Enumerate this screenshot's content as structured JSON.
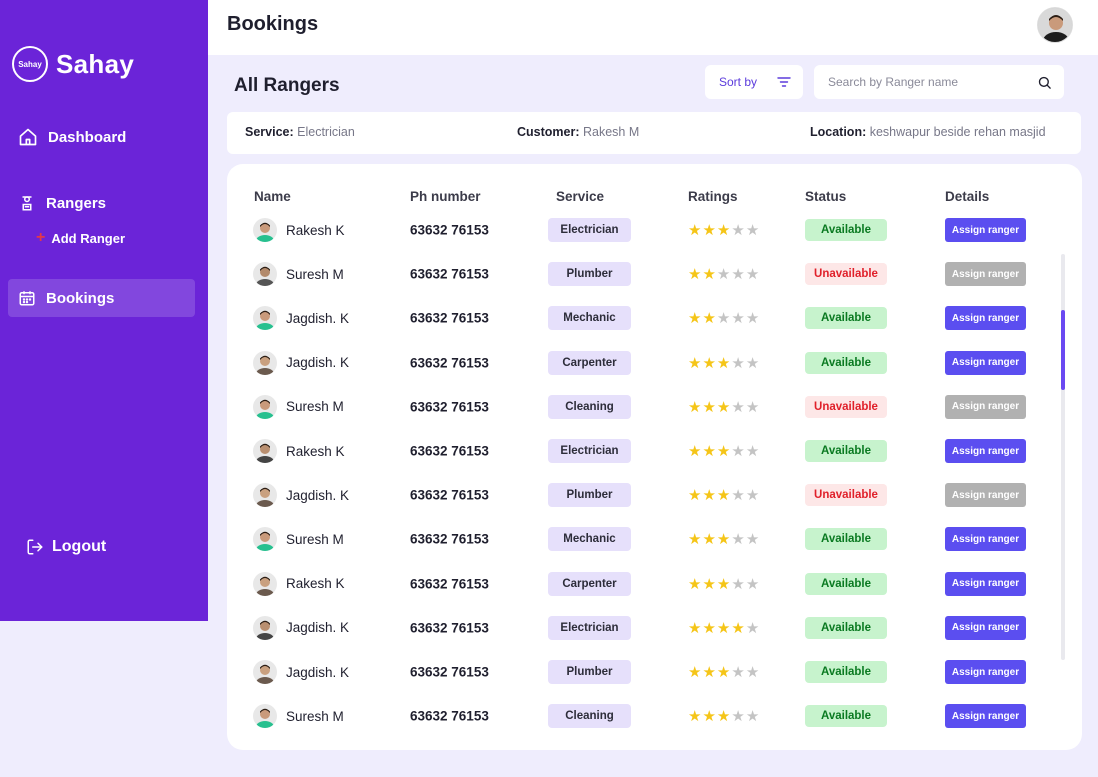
{
  "sidebar": {
    "brand": "Sahay",
    "logo_mark_text": "Sahay",
    "nav": {
      "dashboard": "Dashboard",
      "rangers": "Rangers",
      "add_ranger": "Add Ranger",
      "bookings": "Bookings"
    },
    "logout": "Logout"
  },
  "header": {
    "title": "Bookings"
  },
  "toolbar": {
    "section_title": "All Rangers",
    "sort_label": "Sort by",
    "search_placeholder": "Search by Ranger name"
  },
  "booking_info": {
    "service_label": "Service:",
    "service_value": "Electrician",
    "customer_label": "Customer:",
    "customer_value": "Rakesh M",
    "location_label": "Location:",
    "location_value": "keshwapur beside rehan masjid"
  },
  "table": {
    "columns": [
      "Name",
      "Ph number",
      "Service",
      "Ratings",
      "Status",
      "Details"
    ],
    "assign_label": "Assign ranger",
    "rows": [
      {
        "name": "Rakesh K",
        "phone": "63632 76153",
        "service": "Electrician",
        "rating": 3,
        "status": "Available",
        "available": true
      },
      {
        "name": "Suresh M",
        "phone": "63632 76153",
        "service": "Plumber",
        "rating": 2,
        "status": "Unavailable",
        "available": false
      },
      {
        "name": "Jagdish. K",
        "phone": "63632 76153",
        "service": "Mechanic",
        "rating": 2,
        "status": "Available",
        "available": true
      },
      {
        "name": "Jagdish. K",
        "phone": "63632 76153",
        "service": "Carpenter",
        "rating": 3,
        "status": "Available",
        "available": true
      },
      {
        "name": "Suresh M",
        "phone": "63632 76153",
        "service": "Cleaning",
        "rating": 3,
        "status": "Unavailable",
        "available": false
      },
      {
        "name": "Rakesh K",
        "phone": "63632 76153",
        "service": "Electrician",
        "rating": 3,
        "status": "Available",
        "available": true
      },
      {
        "name": "Jagdish. K",
        "phone": "63632 76153",
        "service": "Plumber",
        "rating": 3,
        "status": "Unavailable",
        "available": false
      },
      {
        "name": "Suresh M",
        "phone": "63632 76153",
        "service": "Mechanic",
        "rating": 3,
        "status": "Available",
        "available": true
      },
      {
        "name": "Rakesh K",
        "phone": "63632 76153",
        "service": "Carpenter",
        "rating": 3,
        "status": "Available",
        "available": true
      },
      {
        "name": "Jagdish. K",
        "phone": "63632 76153",
        "service": "Electrician",
        "rating": 4,
        "status": "Available",
        "available": true
      },
      {
        "name": "Jagdish. K",
        "phone": "63632 76153",
        "service": "Plumber",
        "rating": 3,
        "status": "Available",
        "available": true
      },
      {
        "name": "Suresh M",
        "phone": "63632 76153",
        "service": "Cleaning",
        "rating": 3,
        "status": "Available",
        "available": true
      }
    ]
  }
}
